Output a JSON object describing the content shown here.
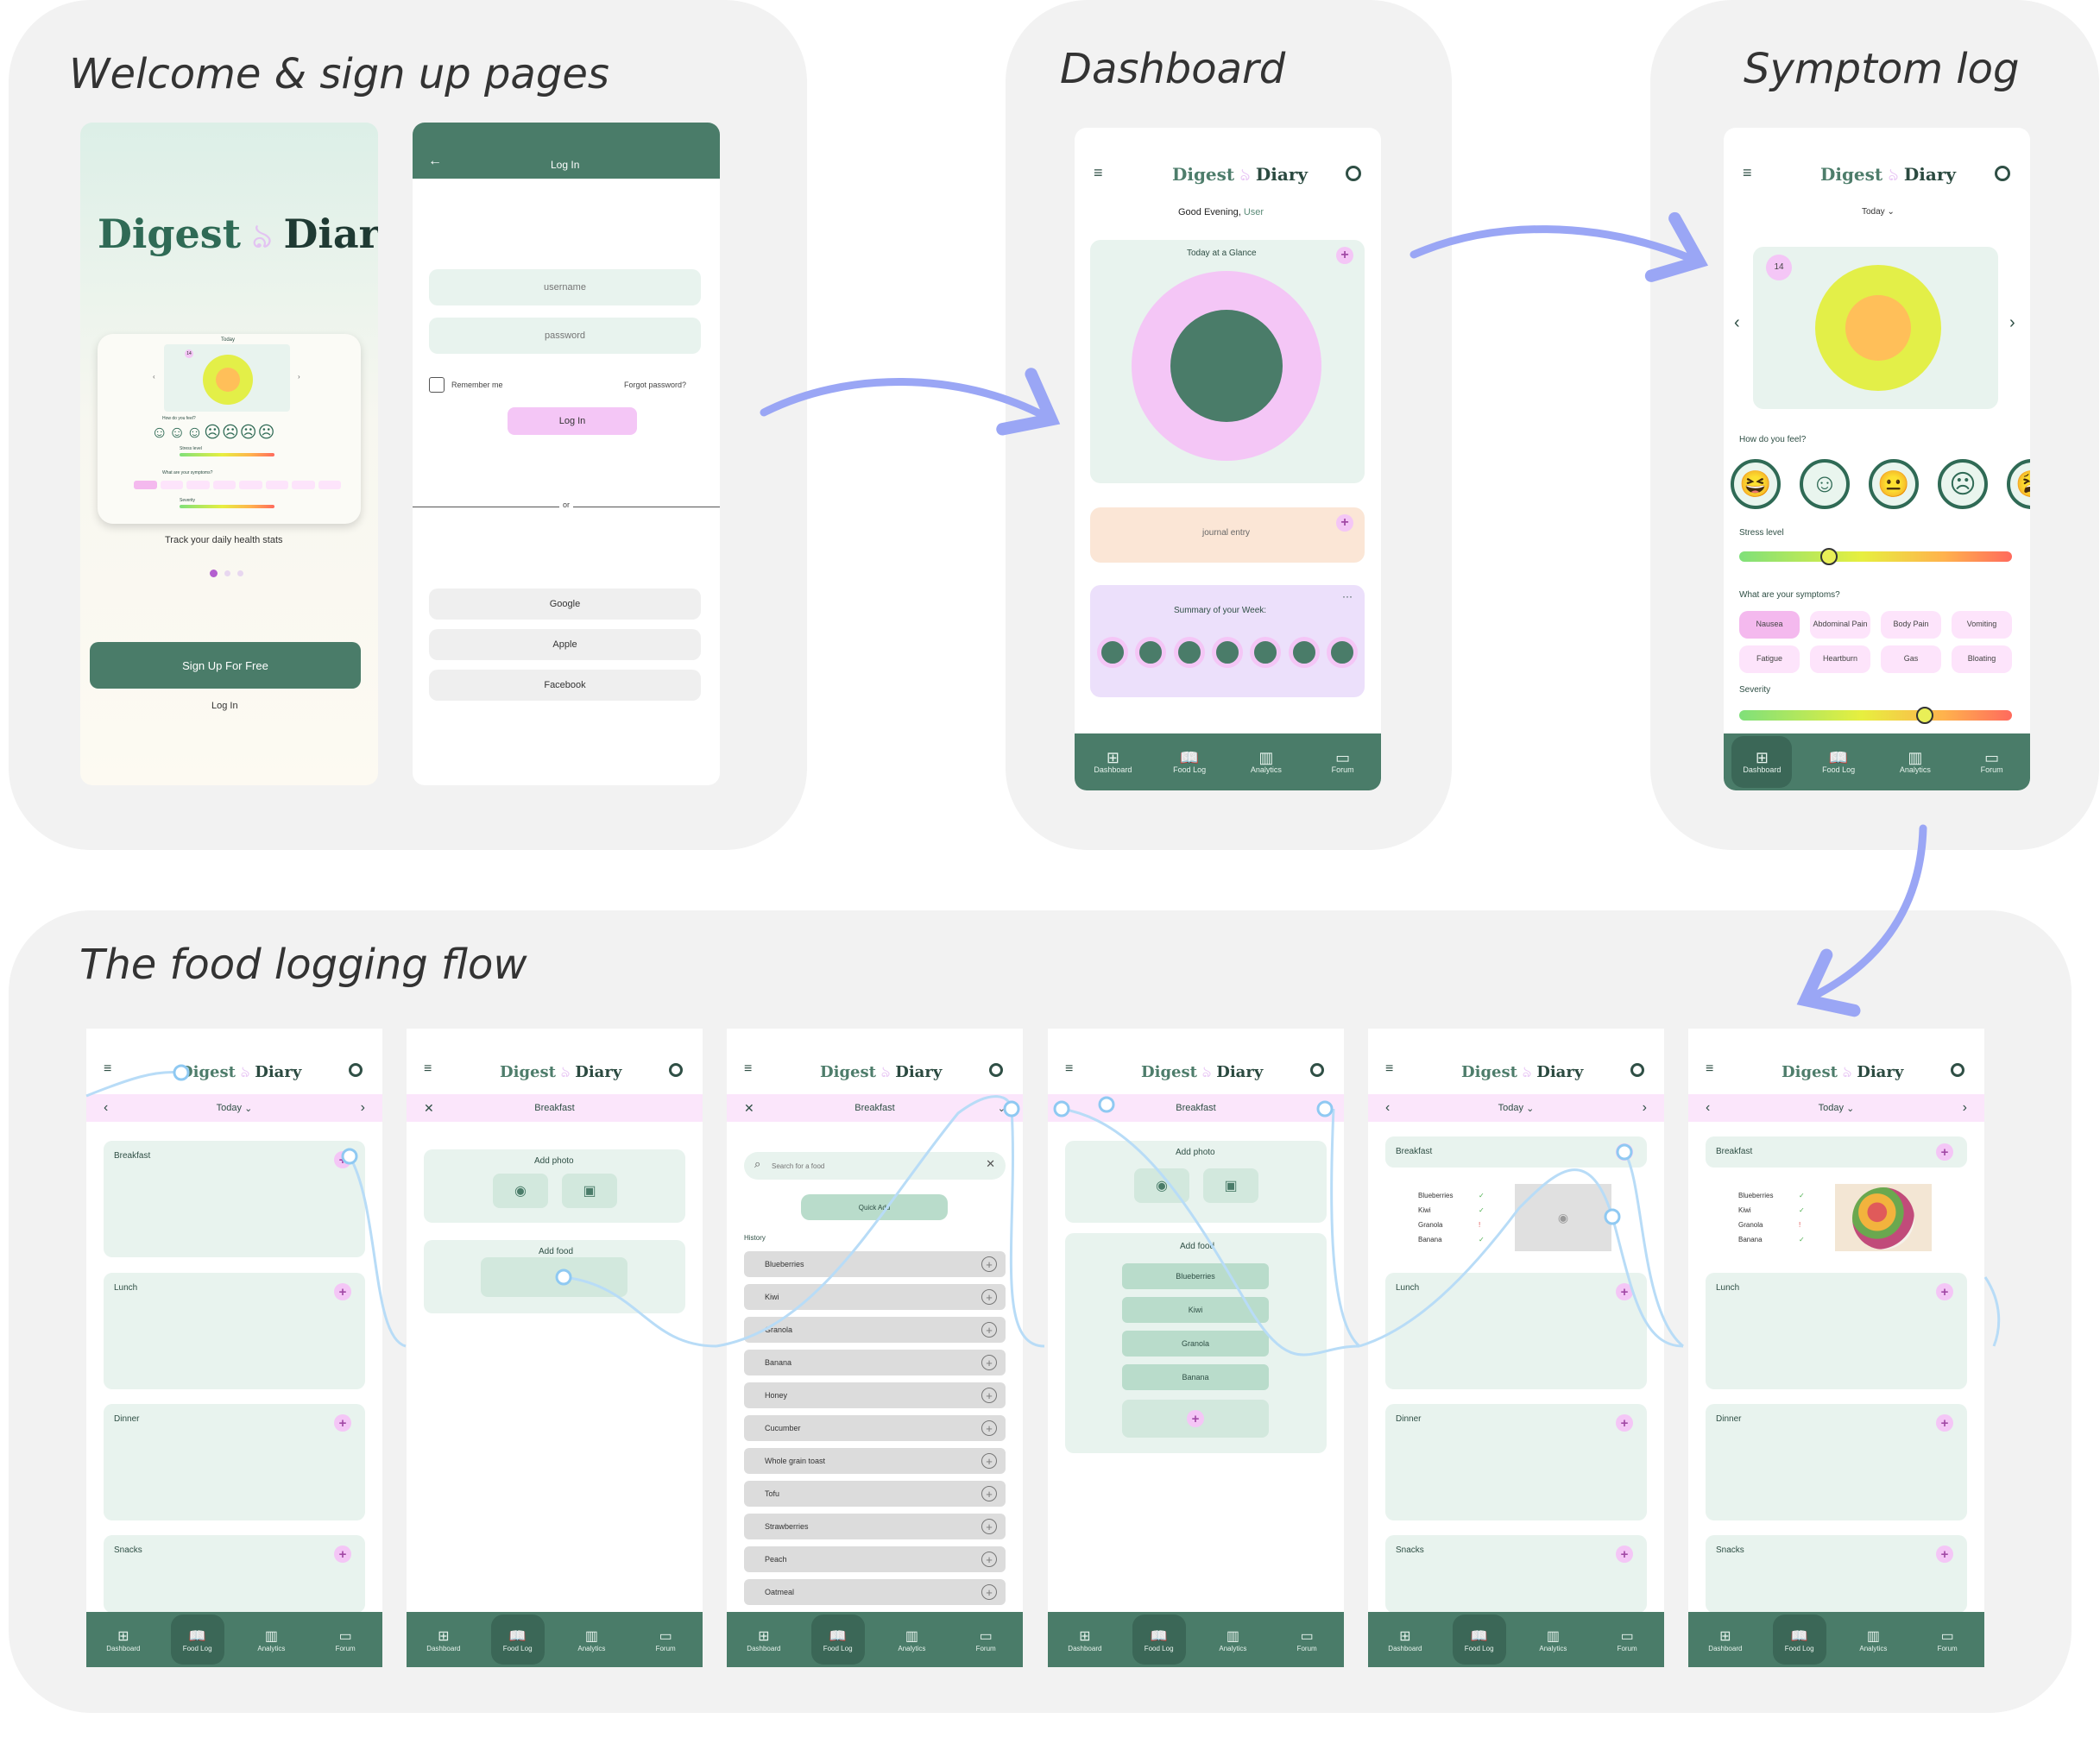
{
  "sections": {
    "welcome": "Welcome & sign up pages",
    "dashboard": "Dashboard",
    "symptom": "Symptom log",
    "food": "The food logging flow"
  },
  "brand": {
    "word1": "Digest",
    "word2": "Diary",
    "flame": "ঌ"
  },
  "welcome": {
    "tagline": "Track your daily health stats",
    "signup": "Sign Up For Free",
    "login": "Log In",
    "mini": {
      "today": "Today",
      "how": "How do you feel?",
      "stress": "Stress level",
      "symptoms": "What are your symptoms?",
      "severity": "Severity",
      "count": "14"
    }
  },
  "login": {
    "back_icon": "arrow-left-icon",
    "title": "Log In",
    "username_placeholder": "username",
    "password_placeholder": "password",
    "remember": "Remember me",
    "forgot": "Forgot password?",
    "login_button": "Log In",
    "or": "or",
    "google": "Google",
    "apple": "Apple",
    "facebook": "Facebook"
  },
  "dashboard": {
    "greeting": "Good Evening,",
    "user": "User",
    "glance": "Today at a Glance",
    "journal": "journal entry",
    "summary": "Summary of your Week:",
    "more": "···"
  },
  "nav": {
    "dashboard": "Dashboard",
    "foodlog": "Food Log",
    "analytics": "Analytics",
    "forum": "Forum"
  },
  "symptom": {
    "today": "Today",
    "day": "14",
    "how": "How do you feel?",
    "stress": "Stress level",
    "symptoms_q": "What are your symptoms?",
    "severity": "Severity",
    "stress_level": 0.33,
    "severity_level": 0.68,
    "chips": [
      "Nausea",
      "Abdominal Pain",
      "Body Pain",
      "Vomiting",
      "Fatigue",
      "Heartburn",
      "Gas",
      "Bloating"
    ]
  },
  "food": {
    "today": "Today",
    "breakfast_title": "Breakfast",
    "meals": [
      "Breakfast",
      "Lunch",
      "Dinner",
      "Snacks"
    ],
    "add_photo": "Add photo",
    "add_food": "Add food",
    "search_placeholder": "Search for a food",
    "quick_add": "Quick Add",
    "history": "History",
    "history_items": [
      "Blueberries",
      "Kiwi",
      "Granola",
      "Banana",
      "Honey",
      "Cucumber",
      "Whole grain toast",
      "Tofu",
      "Strawberries",
      "Peach",
      "Oatmeal"
    ],
    "selected_items": [
      "Blueberries",
      "Kiwi",
      "Granola",
      "Banana"
    ]
  }
}
